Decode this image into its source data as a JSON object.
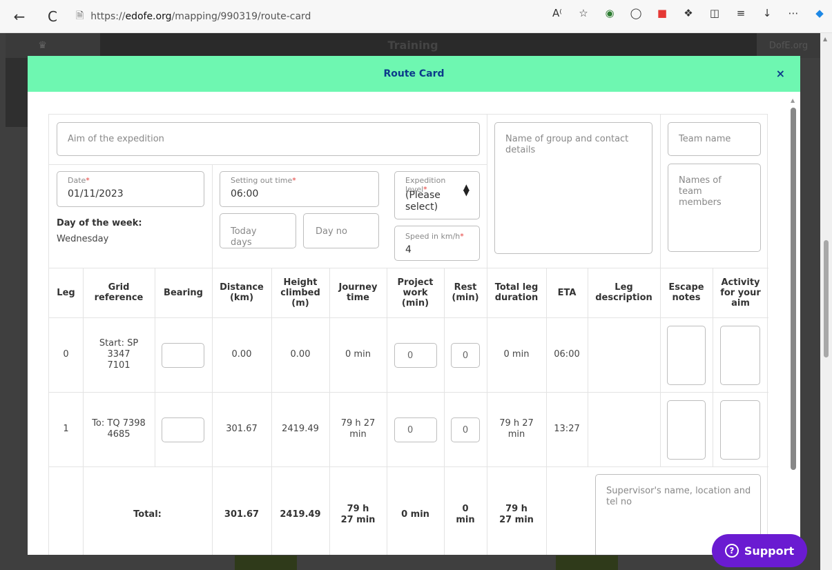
{
  "browser": {
    "url_prefix": "https://",
    "url_host": "edofe.org",
    "url_path": "/mapping/990319/route-card",
    "back": "←",
    "refresh": "C"
  },
  "site": {
    "title": "Training",
    "brand": "DofE.org"
  },
  "modal": {
    "title": "Route Card",
    "close": "×"
  },
  "form": {
    "aim_placeholder": "Aim of the expedition",
    "group_contact_placeholder": "Name of group and contact details",
    "team_name_placeholder": "Team name",
    "team_members_placeholder": "Names of team members",
    "date_label": "Date",
    "date_value": "01/11/2023",
    "setting_out_label": "Setting out time",
    "setting_out_value": "06:00",
    "expedition_level_label": "Expedition level",
    "expedition_level_value": "(Please select)",
    "speed_label": "Speed in km/h",
    "speed_value": "4",
    "today_days_placeholder": "Today days",
    "day_no_placeholder": "Day no",
    "day_of_week_label": "Day of the week:",
    "day_of_week_value": "Wednesday",
    "required_mark": "*"
  },
  "table": {
    "headers": [
      "Leg",
      "Grid reference",
      "Bearing",
      "Distance (km)",
      "Height climbed (m)",
      "Journey time",
      "Project work (min)",
      "Rest (min)",
      "Total leg duration",
      "ETA",
      "Leg description",
      "Escape notes",
      "Activity for your aim"
    ],
    "rows": [
      {
        "leg": "0",
        "grid": "Start: SP 3347 7101",
        "distance": "0.00",
        "height": "0.00",
        "journey": "0 min",
        "project": "0",
        "rest": "0",
        "total": "0 min",
        "eta": "06:00"
      },
      {
        "leg": "1",
        "grid": "To: TQ 7398 4685",
        "distance": "301.67",
        "height": "2419.49",
        "journey": "79 h 27 min",
        "project": "0",
        "rest": "0",
        "total": "79 h 27 min",
        "eta": "13:27"
      }
    ],
    "totals": {
      "label": "Total:",
      "distance": "301.67",
      "height": "2419.49",
      "journey": "79 h 27 min",
      "project": "0 min",
      "rest": "0 min",
      "total": "79 h 27 min"
    },
    "supervisor_placeholder": "Supervisor's name, location and tel no"
  },
  "support": {
    "label": "Support",
    "icon_glyph": "?"
  }
}
